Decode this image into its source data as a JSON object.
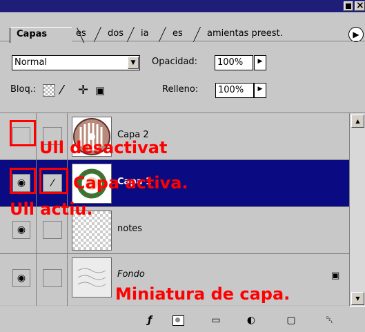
{
  "window": {
    "title_buttons": [
      "minimize-icon",
      "close-icon"
    ]
  },
  "tabs": [
    {
      "label": "Capas",
      "active": true
    },
    {
      "label": "es",
      "active": false
    },
    {
      "label": "dos",
      "active": false
    },
    {
      "label": "ia",
      "active": false
    },
    {
      "label": "es",
      "active": false
    },
    {
      "label": "amientas preest.",
      "active": false
    }
  ],
  "tab_menu_icon": "▶",
  "blend": {
    "mode": "Normal",
    "dropdown_icon": "▼"
  },
  "opacity": {
    "label": "Opacidad:",
    "value": "100%",
    "arrow": "▶"
  },
  "lock": {
    "label": "Bloq.:",
    "paint_icon": "⁄",
    "move_icon": "✛",
    "all_icon": "▣"
  },
  "fill": {
    "label": "Relleno:",
    "value": "100%",
    "arrow": "▶"
  },
  "layers": [
    {
      "name": "Capa 2",
      "visible": false,
      "selected": false
    },
    {
      "name": "Capa 1",
      "visible": true,
      "selected": true,
      "paint_icon": "⁄"
    },
    {
      "name": "notes",
      "visible": true,
      "selected": false
    },
    {
      "name": "Fondo",
      "visible": true,
      "selected": false,
      "locked": true
    }
  ],
  "icons": {
    "eye": "◉",
    "lock": "▣"
  },
  "scrollbar": {
    "up": "▲",
    "down": "▼"
  },
  "bottom_bar": {
    "style": "ƒ",
    "folder": "▭",
    "adjust": "◐",
    "new": "▢",
    "trash": "␡"
  },
  "annotations": {
    "eye_off": "Ull desactivat",
    "active_layer": "Capa activa.",
    "eye_on": "Ull actiu.",
    "thumbnail": "Miniatura de capa."
  },
  "colors": {
    "title": "#1e1e78",
    "selected_row": "#0a0a82",
    "panel": "#c8c8c8",
    "annotation": "#ff0000"
  }
}
